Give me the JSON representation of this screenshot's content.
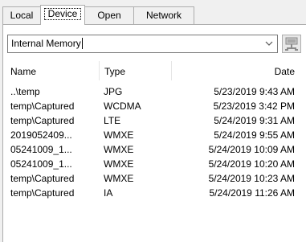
{
  "tabs": [
    {
      "label": "Local"
    },
    {
      "label": "Device"
    },
    {
      "label": "Open"
    },
    {
      "label": "Network"
    }
  ],
  "location": {
    "value": "Internal Memory"
  },
  "columns": {
    "name": "Name",
    "type": "Type",
    "date": "Date"
  },
  "files": [
    {
      "name": "..\\temp",
      "type": "JPG",
      "date": "5/23/2019 9:43 AM"
    },
    {
      "name": "temp\\Captured",
      "type": "WCDMA",
      "date": "5/23/2019 3:42 PM"
    },
    {
      "name": "temp\\Captured",
      "type": "LTE",
      "date": "5/24/2019 9:31 AM"
    },
    {
      "name": "2019052409...",
      "type": "WMXE",
      "date": "5/24/2019 9:55 AM"
    },
    {
      "name": "05241009_1...",
      "type": "WMXE",
      "date": "5/24/2019 10:09 AM"
    },
    {
      "name": "05241009_1...",
      "type": "WMXE",
      "date": "5/24/2019 10:20 AM"
    },
    {
      "name": "temp\\Captured",
      "type": "WMXE",
      "date": "5/24/2019 10:23 AM"
    },
    {
      "name": "temp\\Captured",
      "type": "IA",
      "date": "5/24/2019 11:26 AM"
    }
  ]
}
